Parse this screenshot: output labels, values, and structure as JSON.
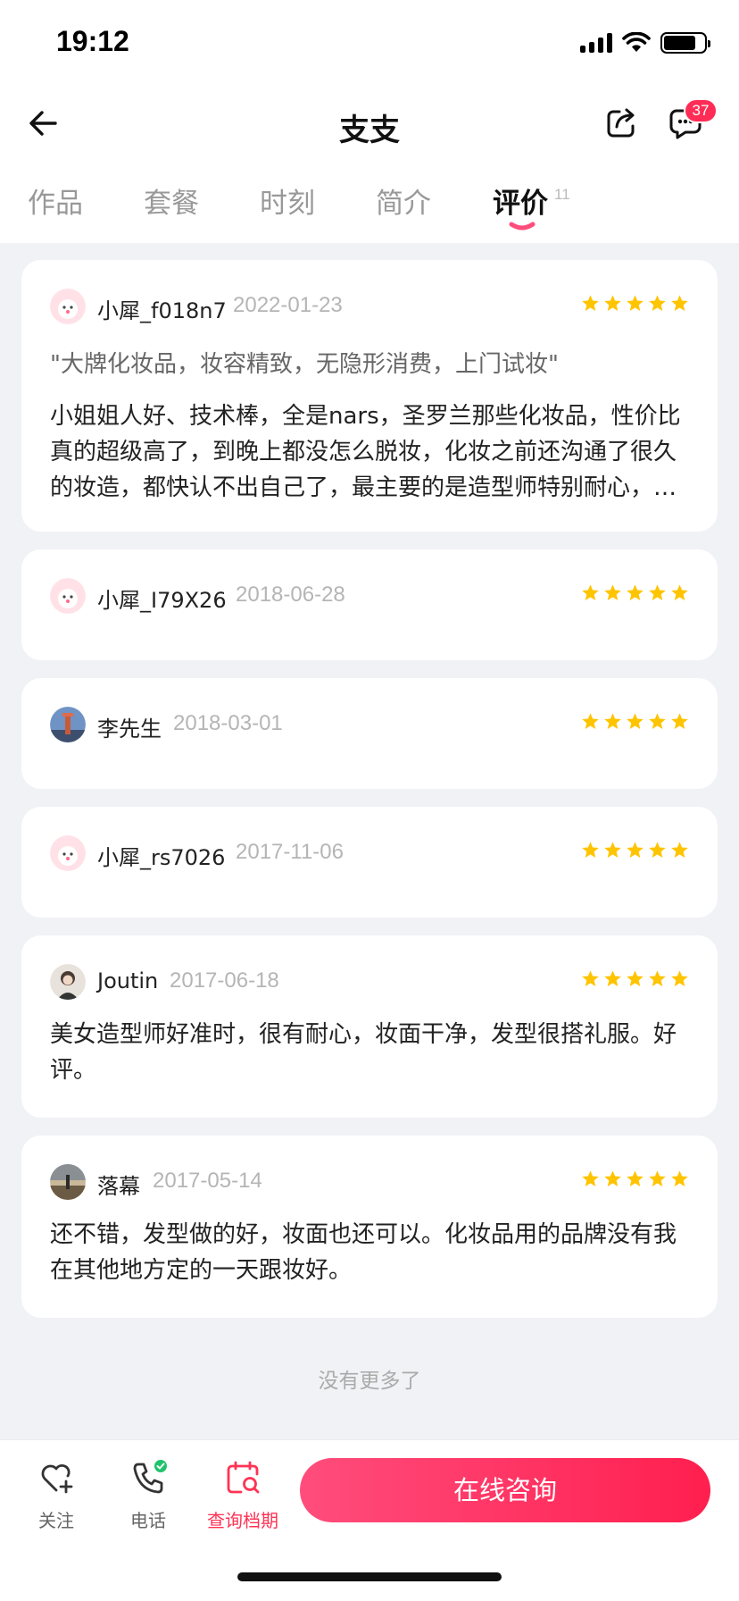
{
  "status_bar": {
    "time": "19:12"
  },
  "header": {
    "title": "支支",
    "badge_count": "37"
  },
  "tabs": [
    {
      "label": "作品"
    },
    {
      "label": "套餐"
    },
    {
      "label": "时刻"
    },
    {
      "label": "简介"
    },
    {
      "label": "评价",
      "count": "11",
      "active": true
    }
  ],
  "reviews": [
    {
      "user": "小犀_f018n7",
      "date": "2022-01-23",
      "rating": 5,
      "quote": "\"大牌化妆品，妆容精致，无隐形消费，上门试妆\"",
      "content": "小姐姐人好、技术棒，全是nars，圣罗兰那些化妆品，性价比真的超级高了，到晚上都没怎么脱妆，化妆之前还沟通了很久的妆造，都快认不出自己了，最主要的是造型师特别耐心，下次还会再来"
    },
    {
      "user": "小犀_I79X26",
      "date": "2018-06-28",
      "rating": 5
    },
    {
      "user": "李先生",
      "date": "2018-03-01",
      "rating": 5
    },
    {
      "user": "小犀_rs7026",
      "date": "2017-11-06",
      "rating": 5
    },
    {
      "user": "Joutin",
      "date": "2017-06-18",
      "rating": 5,
      "content": "美女造型师好准时，很有耐心，妆面干净，发型很搭礼服。好评。"
    },
    {
      "user": "落幕",
      "date": "2017-05-14",
      "rating": 5,
      "content": "还不错，发型做的好，妆面也还可以。化妆品用的品牌没有我在其他地方定的一天跟妆好。"
    }
  ],
  "footer_text": "没有更多了",
  "bottom_bar": {
    "follow_label": "关注",
    "phone_label": "电话",
    "schedule_label": "查询档期",
    "consult_label": "在线咨询"
  },
  "colors": {
    "accent": "#ff2d55",
    "star": "#ffc400",
    "background": "#f1f2f6"
  }
}
